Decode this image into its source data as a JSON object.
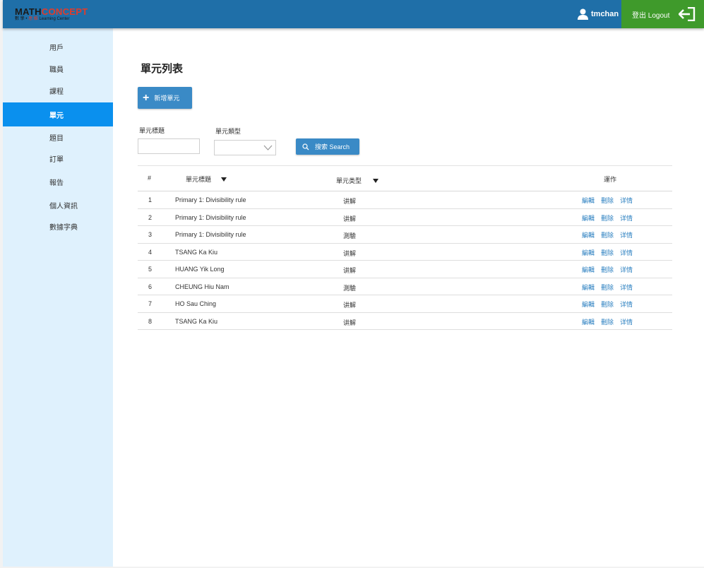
{
  "header": {
    "logo": {
      "part1": "MATH",
      "part2": "CONCEPT",
      "sub1": "數 學 •",
      "sub2": " 思 維 ",
      "sub3": "Learning Center"
    },
    "user_name": "tmchan",
    "logout_label": "登出 Logout",
    "colors": {
      "bar": "#1f6fa8",
      "logout": "#3f9a2b"
    }
  },
  "sidebar": {
    "items": [
      {
        "label": "用戶",
        "active": false
      },
      {
        "label": "職員",
        "active": false
      },
      {
        "label": "課程",
        "active": false
      },
      {
        "label": "單元",
        "active": true
      },
      {
        "label": "題目",
        "active": false
      },
      {
        "label": "訂單",
        "active": false
      },
      {
        "label": "報告",
        "active": false
      },
      {
        "label": "個人資訊",
        "active": false
      },
      {
        "label": "數據字典",
        "active": false
      }
    ],
    "active_color": "#0a90ee"
  },
  "main": {
    "title": "單元列表",
    "add_button_label": "新增單元",
    "filters": {
      "title_label": "單元標題",
      "title_value": "",
      "type_label": "單元類型",
      "type_value": "",
      "search_label": "搜索 Search"
    },
    "table": {
      "headers": {
        "index": "#",
        "title": "單元標題",
        "type": "單元类型",
        "actions": "運作"
      },
      "action_labels": {
        "edit": "編輯",
        "delete": "刪除",
        "detail": "详情"
      },
      "rows": [
        {
          "index": "1",
          "title": "Primary 1: Divisibility rule",
          "type": "讲解"
        },
        {
          "index": "2",
          "title": "Primary 1: Divisibility rule",
          "type": "讲解"
        },
        {
          "index": "3",
          "title": "Primary 1: Divisibility rule",
          "type": "測驗"
        },
        {
          "index": "4",
          "title": "TSANG Ka Kiu",
          "type": "讲解"
        },
        {
          "index": "5",
          "title": "HUANG Yik Long",
          "type": "讲解"
        },
        {
          "index": "6",
          "title": "CHEUNG Hiu Nam",
          "type": "測驗"
        },
        {
          "index": "7",
          "title": "HO Sau Ching",
          "type": "讲解"
        },
        {
          "index": "8",
          "title": "TSANG Ka Kiu",
          "type": "讲解"
        }
      ]
    }
  }
}
